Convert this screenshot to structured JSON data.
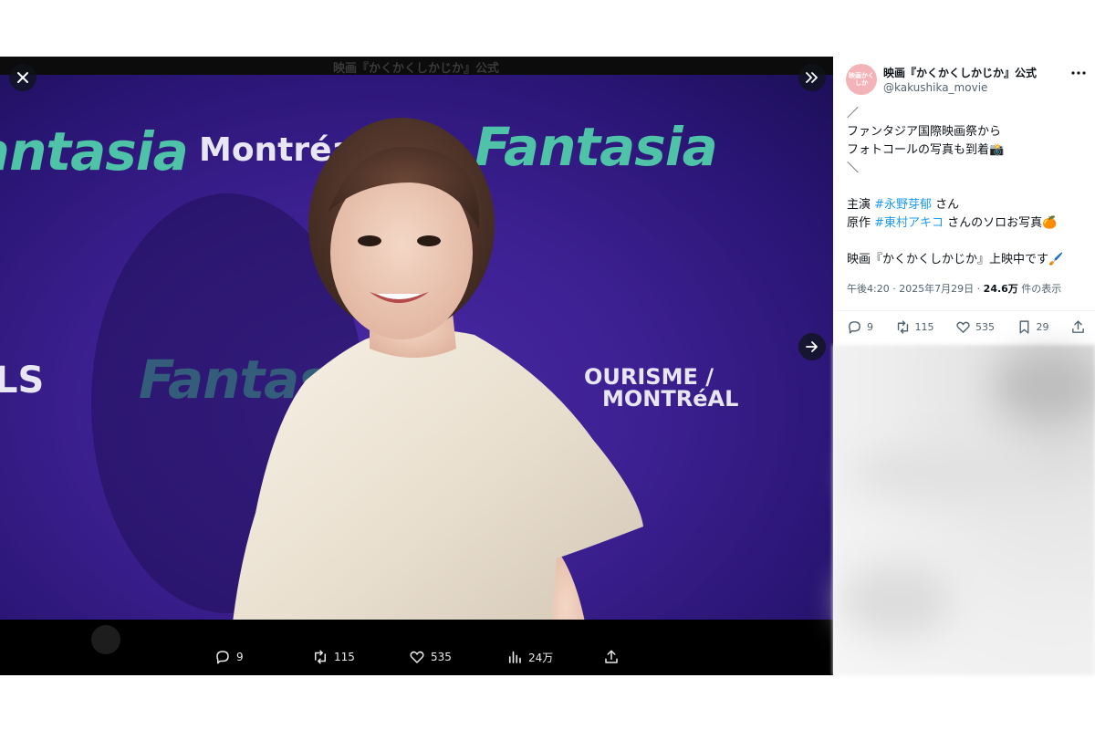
{
  "viewer": {
    "background_title": "映画『かくかくしかじか』公式",
    "background_texts": {
      "fantasia_1": "Fantasia",
      "fantasia_2": "Fantasia",
      "fantasia_3": "Fantasia",
      "montreal": "Montréal",
      "tourism_1": "OURISME /",
      "tourism_2": "MONTRéAL",
      "ls": "LS"
    },
    "bottom_actions": {
      "reply": "9",
      "retweet": "115",
      "like": "535",
      "views": "24万"
    }
  },
  "tweet": {
    "display_name": "映画『かくかくしかじか』公式",
    "handle": "@kakushika_movie",
    "avatar_text": "映画かくしか",
    "lines": {
      "l1": "／",
      "l2": "ファンタジア国際映画祭から",
      "l3": "フォトコールの写真も到着📸",
      "l4": "＼",
      "l5_prefix": "主演 ",
      "l5_tag": "#永野芽郁",
      "l5_suffix": " さん",
      "l6_prefix": "原作 ",
      "l6_tag": "#東村アキコ",
      "l6_suffix": " さんのソロお写真🍊",
      "l7": "映画『かくかくしかじか』上映中です🖌️"
    },
    "timestamp": "午後4:20 · 2025年7月29日 · ",
    "views_count": "24.6万",
    "views_label": " 件の表示",
    "actions": {
      "reply": "9",
      "retweet": "115",
      "like": "535",
      "bookmark": "29"
    }
  },
  "icons": {
    "close": "close-icon",
    "expand": "double-chevron-right-icon",
    "next": "arrow-right-icon",
    "more": "more-icon",
    "reply": "reply-icon",
    "retweet": "retweet-icon",
    "like": "heart-icon",
    "views": "views-icon",
    "bookmark": "bookmark-icon",
    "share": "share-icon"
  },
  "colors": {
    "hashtag": "#1d9bf0",
    "backdrop": "#3b1f8f",
    "fantasia_logo": "#4fc3a7"
  }
}
